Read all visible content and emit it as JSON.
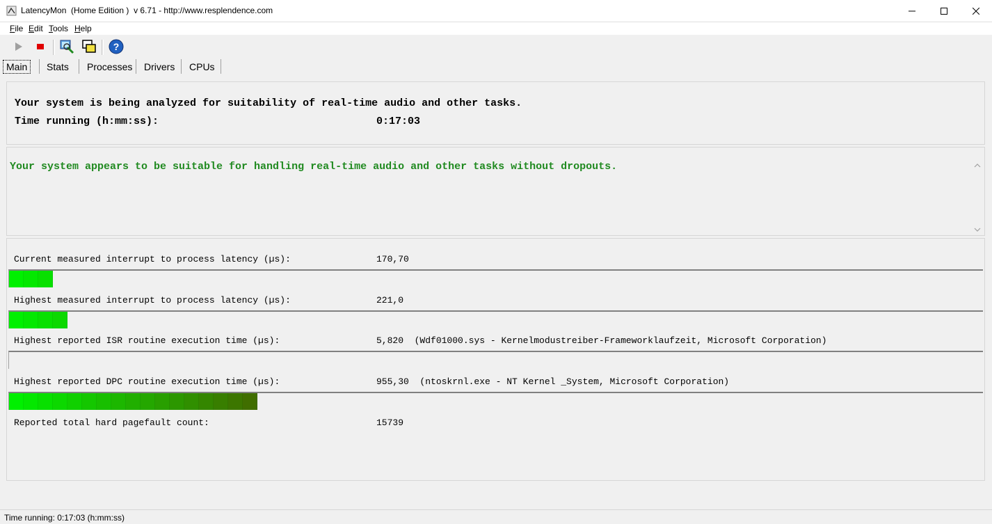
{
  "window": {
    "title": "LatencyMon  (Home Edition )  v 6.71 - http://www.resplendence.com",
    "icon": "latencymon-app-icon"
  },
  "menu": [
    {
      "label": "File",
      "accel": "F",
      "rest": "ile"
    },
    {
      "label": "Edit",
      "accel": "E",
      "rest": "dit"
    },
    {
      "label": "Tools",
      "accel": "T",
      "rest": "ools"
    },
    {
      "label": "Help",
      "accel": "H",
      "rest": "elp"
    }
  ],
  "toolbar": {
    "buttons": [
      "play-icon",
      "stop-icon",
      "analyze-icon",
      "windows-icon",
      "help-icon"
    ]
  },
  "tabs": [
    {
      "label": "Main",
      "active": true
    },
    {
      "label": "Stats",
      "active": false
    },
    {
      "label": "Processes",
      "active": false
    },
    {
      "label": "Drivers",
      "active": false
    },
    {
      "label": "CPUs",
      "active": false
    }
  ],
  "header": {
    "line1": "Your system is being analyzed for suitability of real-time audio and other tasks.",
    "time_label": "Time running (h:mm:ss):",
    "time_value": "0:17:03"
  },
  "verdict": {
    "message": "Your system appears to be suitable for handling real-time audio and other tasks without dropouts.",
    "color": "#208a20"
  },
  "metrics": [
    {
      "label": "Current measured interrupt to process latency (µs):",
      "value": "170,70",
      "detail": "",
      "level_segments": 3
    },
    {
      "label": "Highest measured interrupt to process latency (µs):",
      "value": "221,0",
      "detail": "",
      "level_segments": 4
    },
    {
      "label": "Highest reported ISR routine execution time (µs):",
      "value": "5,820",
      "detail": "(Wdf01000.sys - Kernelmodustreiber-Frameworklaufzeit, Microsoft Corporation)",
      "level_segments": 0
    },
    {
      "label": "Highest reported DPC routine execution time (µs):",
      "value": "955,30",
      "detail": "(ntoskrnl.exe - NT Kernel _System, Microsoft Corporation)",
      "level_segments": 17
    }
  ],
  "pagefault": {
    "label": "Reported total hard pagefault count:",
    "value": "15739"
  },
  "status": {
    "text": "Time running: 0:17:03  (h:mm:ss)"
  }
}
